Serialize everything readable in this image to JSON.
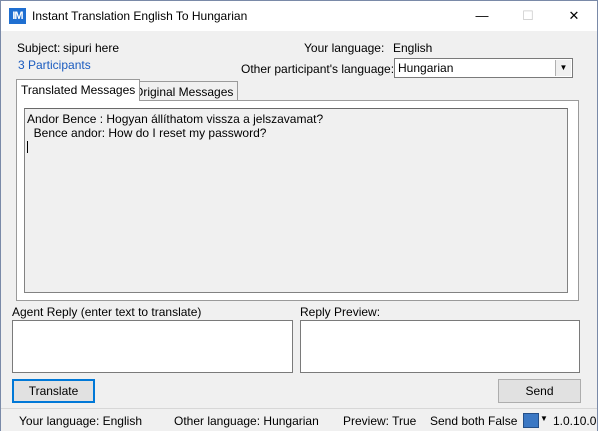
{
  "window": {
    "title": "Instant Translation  English To Hungarian",
    "icon_text": "IM",
    "controls": {
      "minimize": "—",
      "maximize": "☐",
      "close": "✕"
    }
  },
  "header": {
    "subject_label": "Subject:",
    "subject_value": "sipuri here",
    "participants": "3  Participants",
    "your_language_label": "Your language:",
    "your_language_value": "English",
    "other_language_label": "Other participant's language:",
    "other_language_value": "Hungarian"
  },
  "tabs": [
    {
      "label": "Translated Messages",
      "active": true
    },
    {
      "label": "Original Messages",
      "active": false
    }
  ],
  "messages": [
    "Andor Bence : Hogyan állíthatom vissza a jelszavamat?",
    "  Bence andor: How do I reset my password?"
  ],
  "reply": {
    "agent_label": "Agent Reply (enter text to translate)",
    "agent_value": "",
    "preview_label": "Reply Preview:",
    "preview_value": ""
  },
  "buttons": {
    "translate": "Translate",
    "send": "Send"
  },
  "status": {
    "your_language": "Your language:  English",
    "other_language": "Other language: Hungarian",
    "preview": "Preview: True",
    "send_both": "Send both False",
    "version": "1.0.10.0"
  },
  "colors": {
    "link": "#1a5bbf",
    "accent": "#0078d7"
  }
}
